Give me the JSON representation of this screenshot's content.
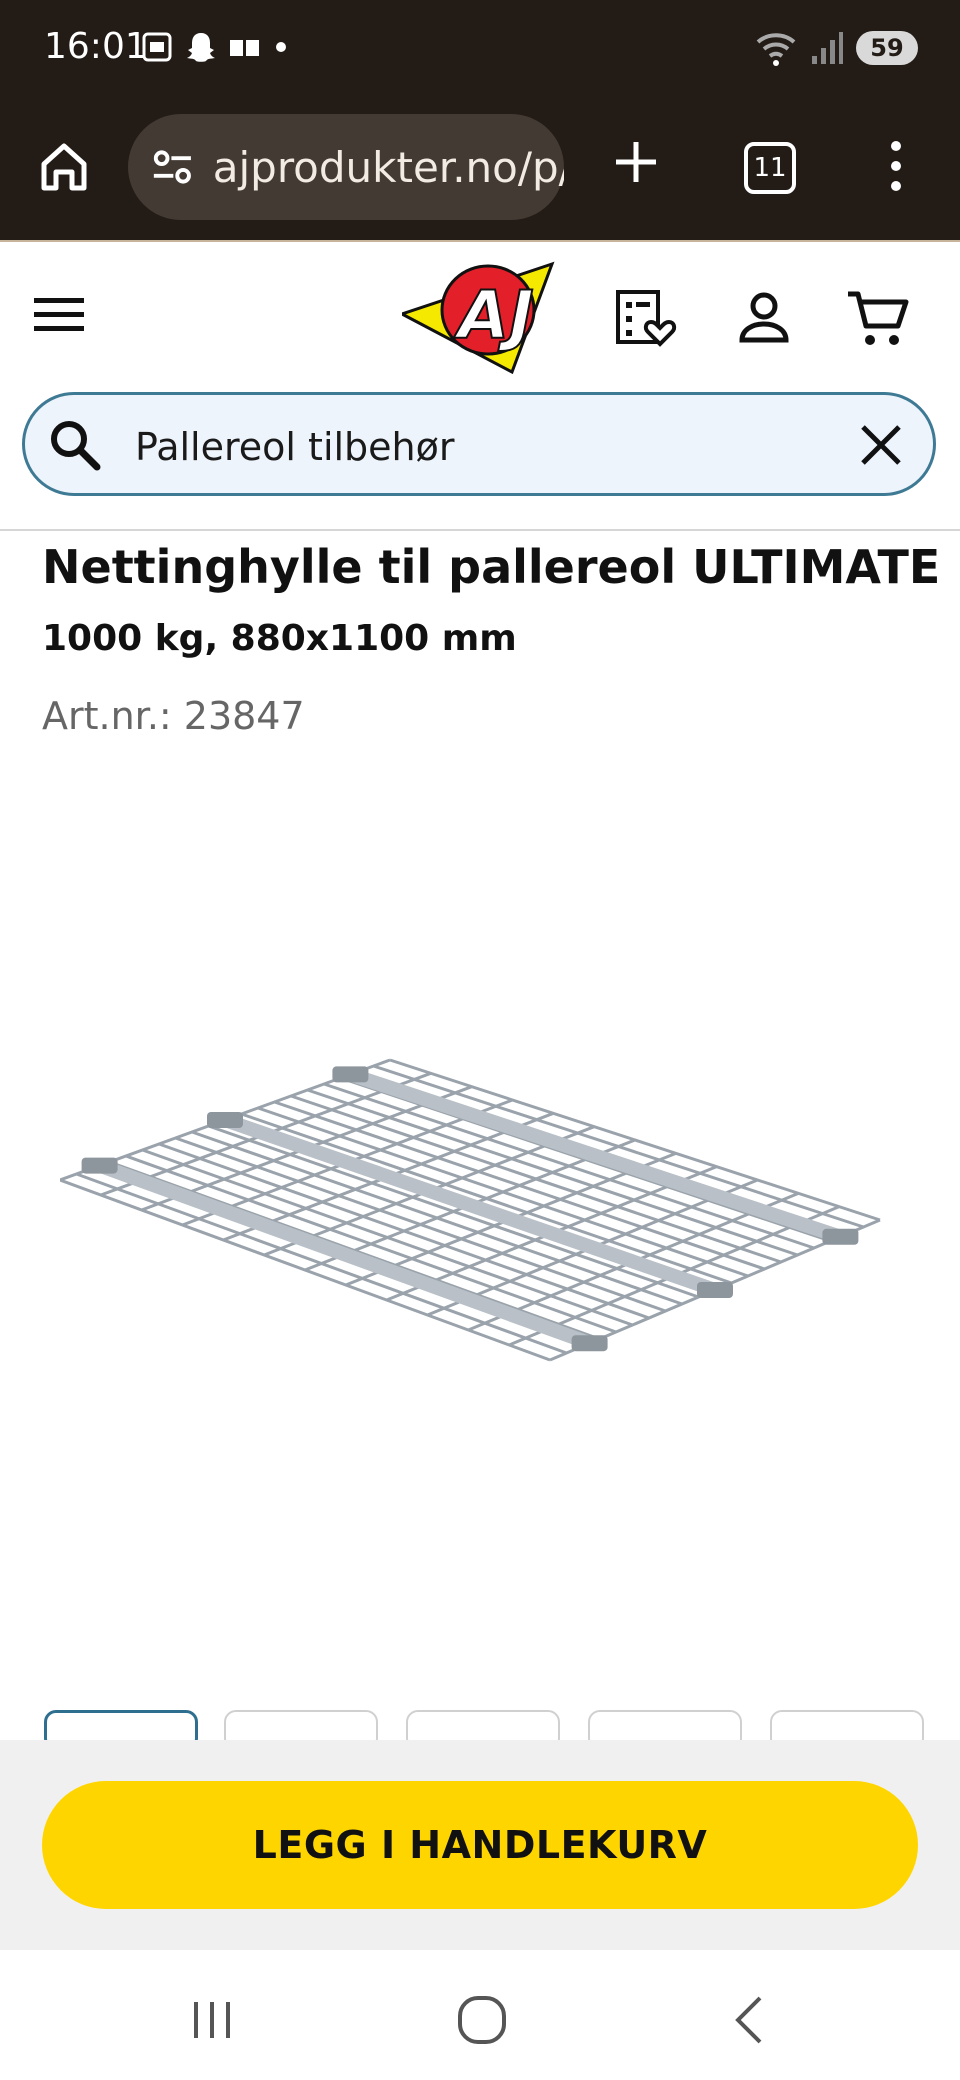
{
  "status_bar": {
    "time": "16:01",
    "battery": "59"
  },
  "browser": {
    "url": "ajprodukter.no/p/",
    "tab_count": "11"
  },
  "search": {
    "value": "Pallereol tilbehør"
  },
  "product": {
    "title": "Nettinghylle til pallereol ULTIMATE",
    "subtitle": "1000 kg, 880x1100 mm",
    "art_nr": "Art.nr.: 23847"
  },
  "cart_button": {
    "label": "LEGG I HANDLEKURV"
  },
  "colors": {
    "accent_yellow": "#ffd500",
    "search_border": "#3f7a95",
    "browser_bg": "#231b15"
  },
  "logo": {
    "text": "AJ"
  },
  "icons": [
    "home-icon",
    "tune-icon",
    "plus-icon",
    "tabs-icon",
    "more-vert-icon",
    "hamburger-icon",
    "favorites-list-icon",
    "account-icon",
    "cart-icon",
    "search-icon",
    "close-icon"
  ]
}
